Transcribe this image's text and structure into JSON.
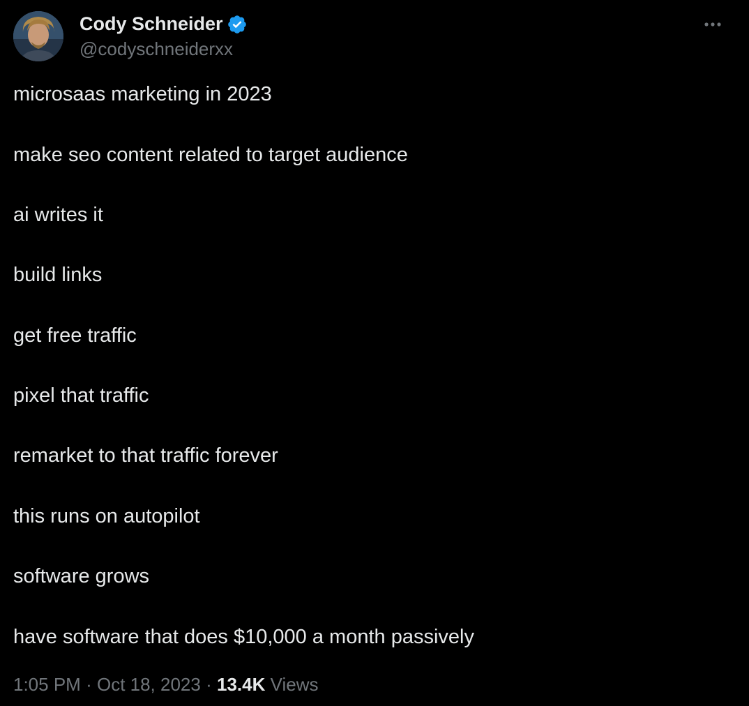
{
  "author": {
    "name": "Cody Schneider",
    "handle": "@codyschneiderxx",
    "verified": true,
    "avatar_icon": "profile-photo"
  },
  "more_icon": "ellipsis-icon",
  "tweet": {
    "lines": [
      "microsaas marketing in 2023",
      "make seo content related to target audience",
      "ai writes it",
      "build links",
      "get free traffic",
      "pixel that traffic",
      "remarket to that traffic forever",
      "this runs on autopilot",
      "software grows",
      "have software that does $10,000 a month passively"
    ]
  },
  "meta": {
    "time": "1:05 PM",
    "separator": "·",
    "date": "Oct 18, 2023",
    "views_count": "13.4K",
    "views_label": "Views"
  },
  "colors": {
    "background": "#000000",
    "text": "#e7e9ea",
    "secondary": "#71767b",
    "verified": "#1d9bf0"
  }
}
